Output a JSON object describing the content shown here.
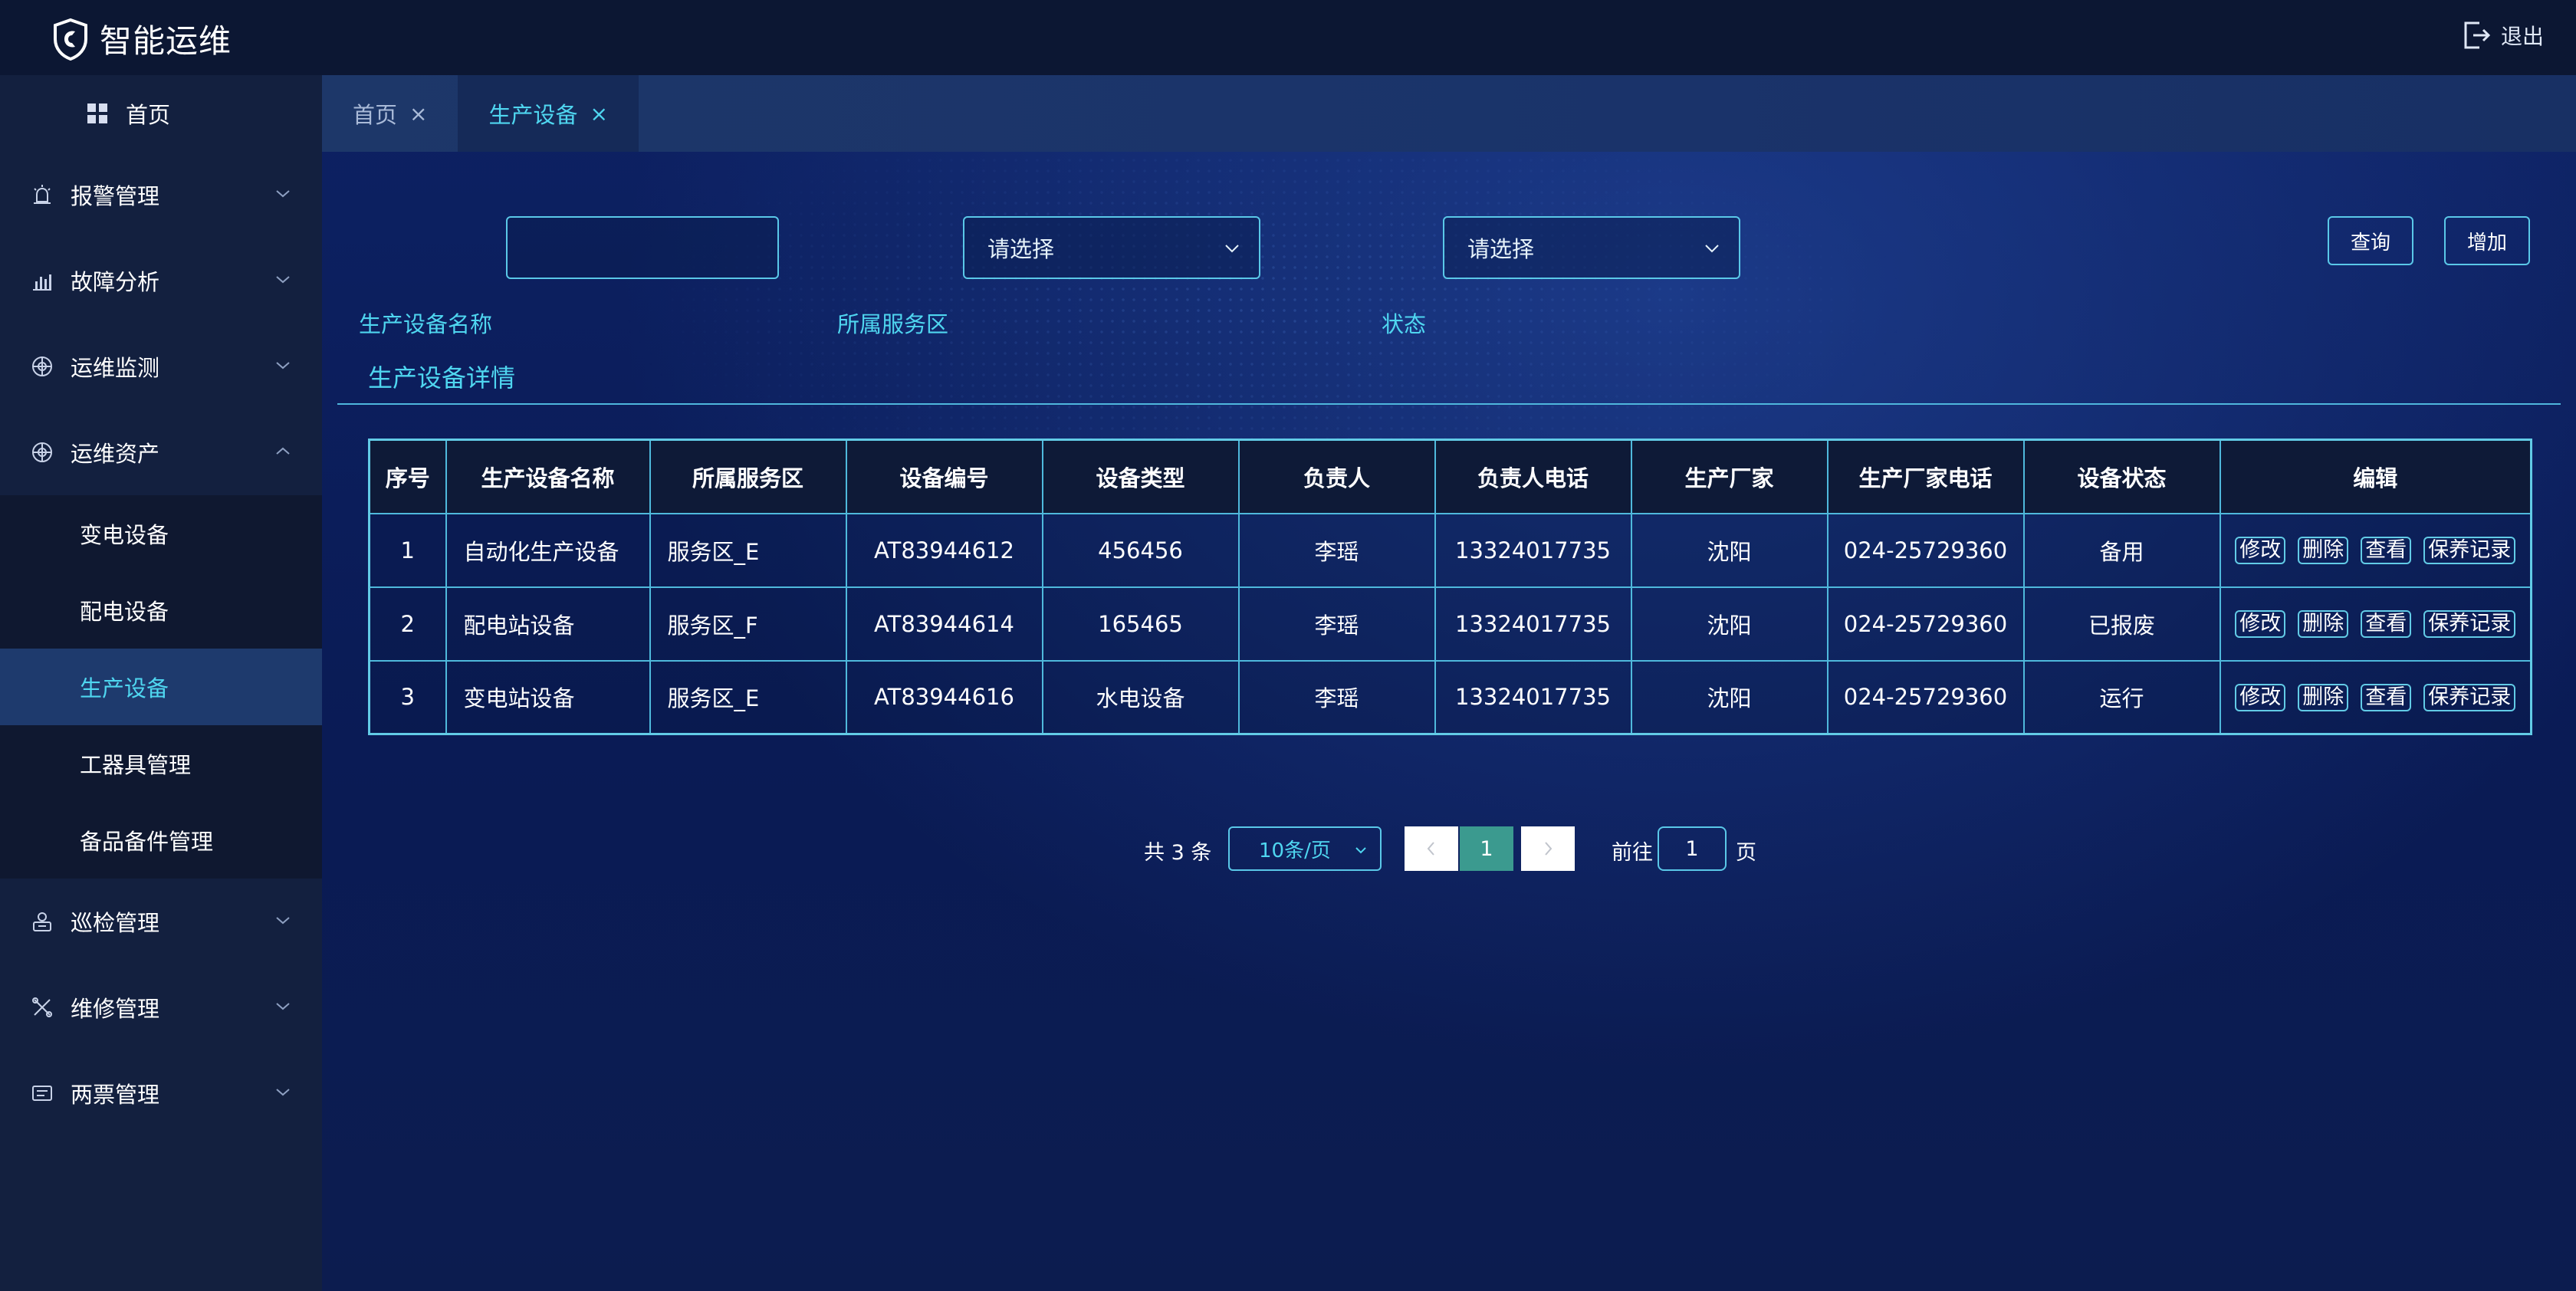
{
  "app": {
    "title": "智能运维",
    "logout_label": "退出"
  },
  "sidebar": {
    "home": "首页",
    "items": [
      {
        "label": "报警管理",
        "icon": "alarm-icon",
        "expanded": false
      },
      {
        "label": "故障分析",
        "icon": "bar-chart-icon",
        "expanded": false
      },
      {
        "label": "运维监测",
        "icon": "monitor-icon",
        "expanded": false
      },
      {
        "label": "运维资产",
        "icon": "asset-icon",
        "expanded": true
      },
      {
        "label": "巡检管理",
        "icon": "inspection-icon",
        "expanded": false
      },
      {
        "label": "维修管理",
        "icon": "tools-icon",
        "expanded": false
      },
      {
        "label": "两票管理",
        "icon": "ticket-icon",
        "expanded": false
      }
    ],
    "sub_items": [
      "变电设备",
      "配电设备",
      "生产设备",
      "工器具管理",
      "备品备件管理"
    ],
    "active_sub": "生产设备"
  },
  "tabs": [
    {
      "label": "首页",
      "close": "×",
      "active": false
    },
    {
      "label": "生产设备",
      "close": "×",
      "active": true
    }
  ],
  "filters": {
    "name_label": "生产设备名称",
    "name_value": "",
    "zone_label": "所属服务区",
    "zone_placeholder": "请选择",
    "status_label": "状态",
    "status_placeholder": "请选择",
    "query_label": "查询",
    "add_label": "增加"
  },
  "section_title": "生产设备详情",
  "table": {
    "headers": [
      "序号",
      "生产设备名称",
      "所属服务区",
      "设备编号",
      "设备类型",
      "负责人",
      "负责人电话",
      "生产厂家",
      "生产厂家电话",
      "设备状态",
      "编辑"
    ],
    "rows": [
      [
        "1",
        "自动化生产设备",
        "服务区_E",
        "AT83944612",
        "456456",
        "李瑶",
        "13324017735",
        "沈阳",
        "024-25729360",
        "备用"
      ],
      [
        "2",
        "配电站设备",
        "服务区_F",
        "AT83944614",
        "165465",
        "李瑶",
        "13324017735",
        "沈阳",
        "024-25729360",
        "已报废"
      ],
      [
        "3",
        "变电站设备",
        "服务区_E",
        "AT83944616",
        "水电设备",
        "李瑶",
        "13324017735",
        "沈阳",
        "024-25729360",
        "运行"
      ]
    ],
    "actions": [
      "修改",
      "删除",
      "查看",
      "保养记录"
    ]
  },
  "pagination": {
    "total_text": "共 3 条",
    "page_size": "10条/页",
    "current_page": "1",
    "goto_label": "前往",
    "goto_value": "1",
    "page_unit": "页"
  },
  "colors": {
    "accent": "#4fd6f0",
    "border": "#5ac8e8",
    "header_bg": "#0c1733",
    "sidebar_bg": "#13203f",
    "active_item_bg": "#1e3a6d",
    "page_active": "#3b9a8f"
  }
}
